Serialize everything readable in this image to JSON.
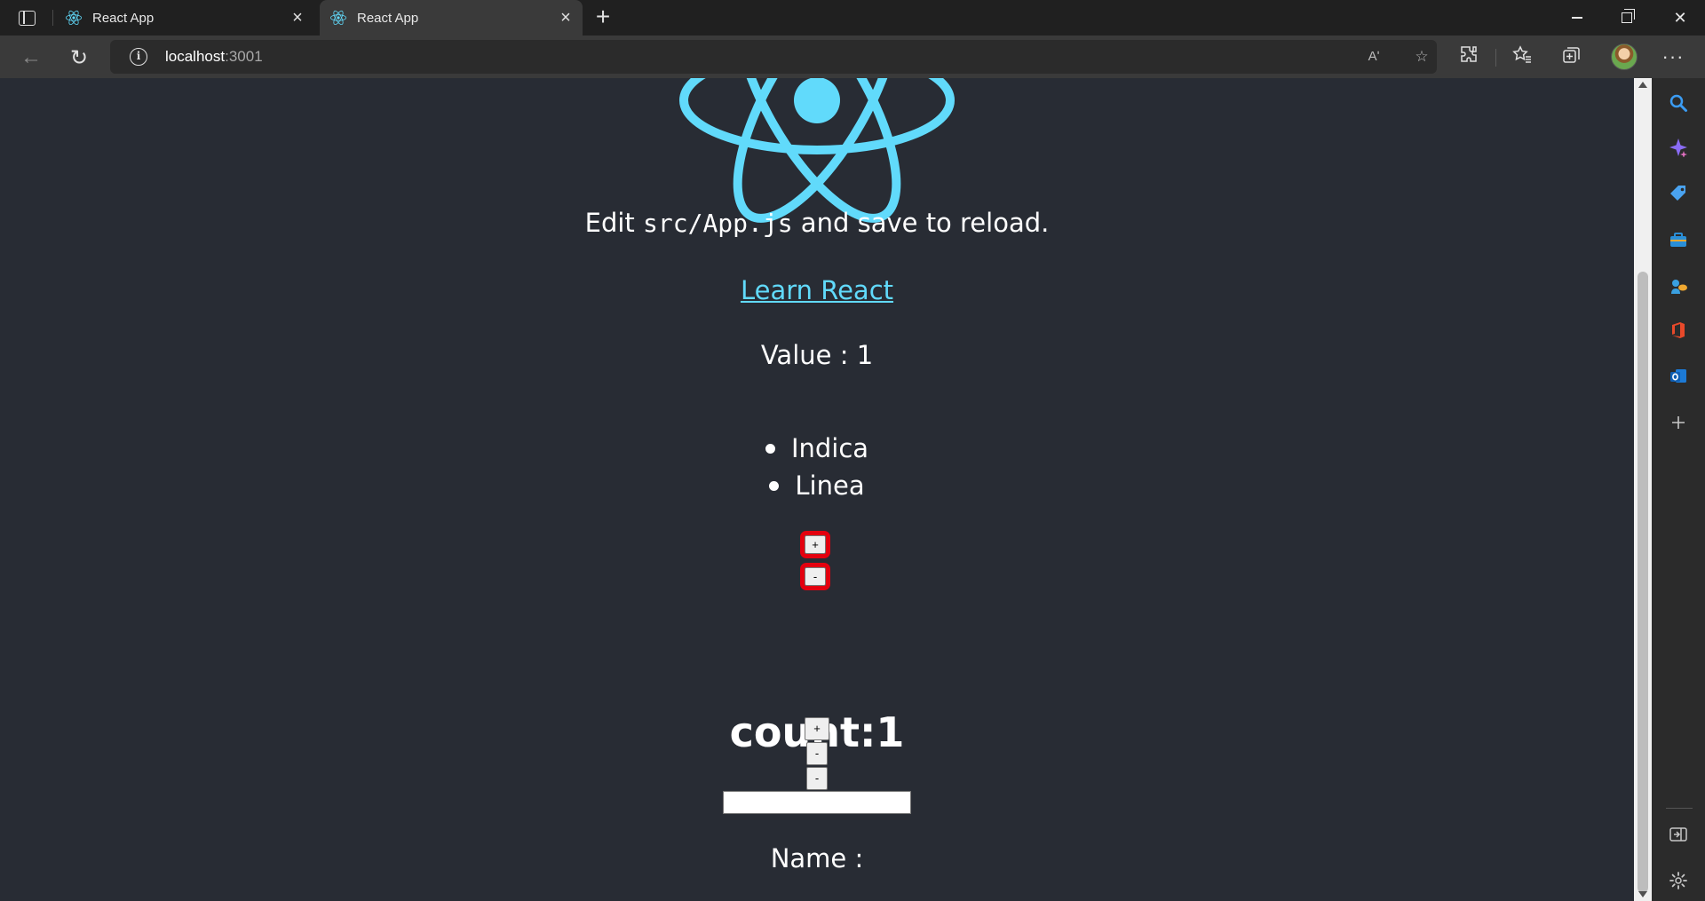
{
  "browser": {
    "tabs": [
      {
        "title": "React App",
        "active": false
      },
      {
        "title": "React App",
        "active": true
      }
    ],
    "address": {
      "host": "localhost",
      "port": ":3001"
    },
    "colors": {
      "titlebar": "#202020",
      "toolbar": "#3a3a3a",
      "page_bg": "#282c34",
      "link": "#61dafb",
      "highlight": "#e3000f"
    },
    "icons": {
      "tab_close": "×",
      "new_tab": "+",
      "back": "←",
      "reload": "↻",
      "site_info": "i",
      "read_aloud": "Aʹ",
      "favorite_add": "☆",
      "extensions": "⧉",
      "favorites": "☆",
      "collections": "⧉",
      "more": "···",
      "close_window": "✕"
    }
  },
  "page": {
    "edit_prefix": "Edit ",
    "edit_code": "src/App.js",
    "edit_suffix": " and save to reload.",
    "learn_link": "Learn React",
    "value_line": "Value : 1",
    "list_items": [
      "Indica",
      "Linea"
    ],
    "plus_label": "+",
    "minus_label": "-",
    "count_heading": "count:1",
    "counter_buttons": [
      "+",
      "-",
      "-"
    ],
    "text_input_value": "",
    "name_line": "Name :"
  },
  "sidebar": {
    "icons": [
      "search-icon",
      "copilot-icon",
      "shopping-tag-icon",
      "tools-icon",
      "games-icon",
      "office-icon",
      "outlook-icon",
      "add-icon",
      "split-screen-icon",
      "settings-icon"
    ]
  }
}
